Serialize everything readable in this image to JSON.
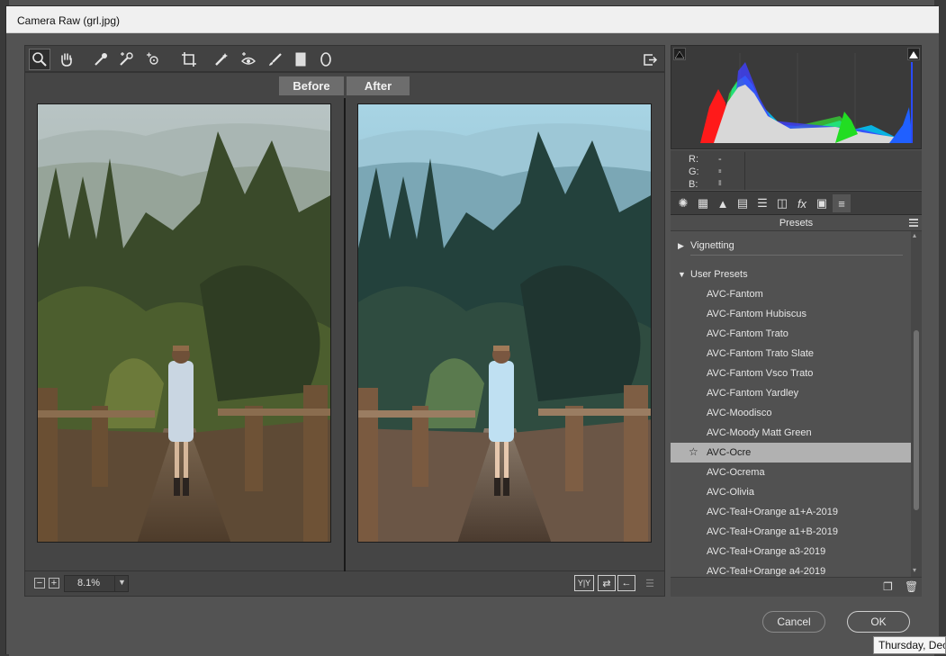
{
  "window": {
    "title": "Camera Raw (grl.jpg)"
  },
  "toolbar": {
    "tools": [
      "zoom-tool",
      "hand-tool",
      "white-balance-tool",
      "color-sampler-tool",
      "targeted-adjustment-tool",
      "crop-tool",
      "spot-removal-tool",
      "red-eye-tool",
      "adjustment-brush-tool",
      "graduated-filter-tool",
      "radial-filter-tool"
    ],
    "active_tool": "zoom-tool"
  },
  "preview": {
    "before_label": "Before",
    "after_label": "After"
  },
  "zoom": {
    "value": "8.1%",
    "minus": "−",
    "plus": "+"
  },
  "view_buttons": {
    "yy": "Y|Y"
  },
  "readout": {
    "r_label": "R:",
    "g_label": "G:",
    "b_label": "B:",
    "r_value": "---",
    "g_value": "---",
    "b_value": "---"
  },
  "panel": {
    "header": "Presets",
    "groups": {
      "vignetting": "Vignetting",
      "user_presets": "User Presets"
    },
    "presets": [
      "AVC-Fantom",
      "AVC-Fantom Hubiscus",
      "AVC-Fantom Trato",
      "AVC-Fantom Trato Slate",
      "AVC-Fantom Vsco Trato",
      "AVC-Fantom Yardley",
      "AVC-Moodisco",
      "AVC-Moody Matt Green",
      "AVC-Ocre",
      "AVC-Ocrema",
      "AVC-Olivia",
      "AVC-Teal+Orange a1+A-2019",
      "AVC-Teal+Orange a1+B-2019",
      "AVC-Teal+Orange a3-2019",
      "AVC-Teal+Orange a4-2019"
    ],
    "selected": "AVC-Ocre"
  },
  "buttons": {
    "cancel": "Cancel",
    "ok": "OK"
  },
  "tooltip": "Thursday, Dec",
  "colors": {
    "selected_row": "#b1b1b1",
    "panel_bg": "#515151",
    "window_bg": "#535353"
  }
}
